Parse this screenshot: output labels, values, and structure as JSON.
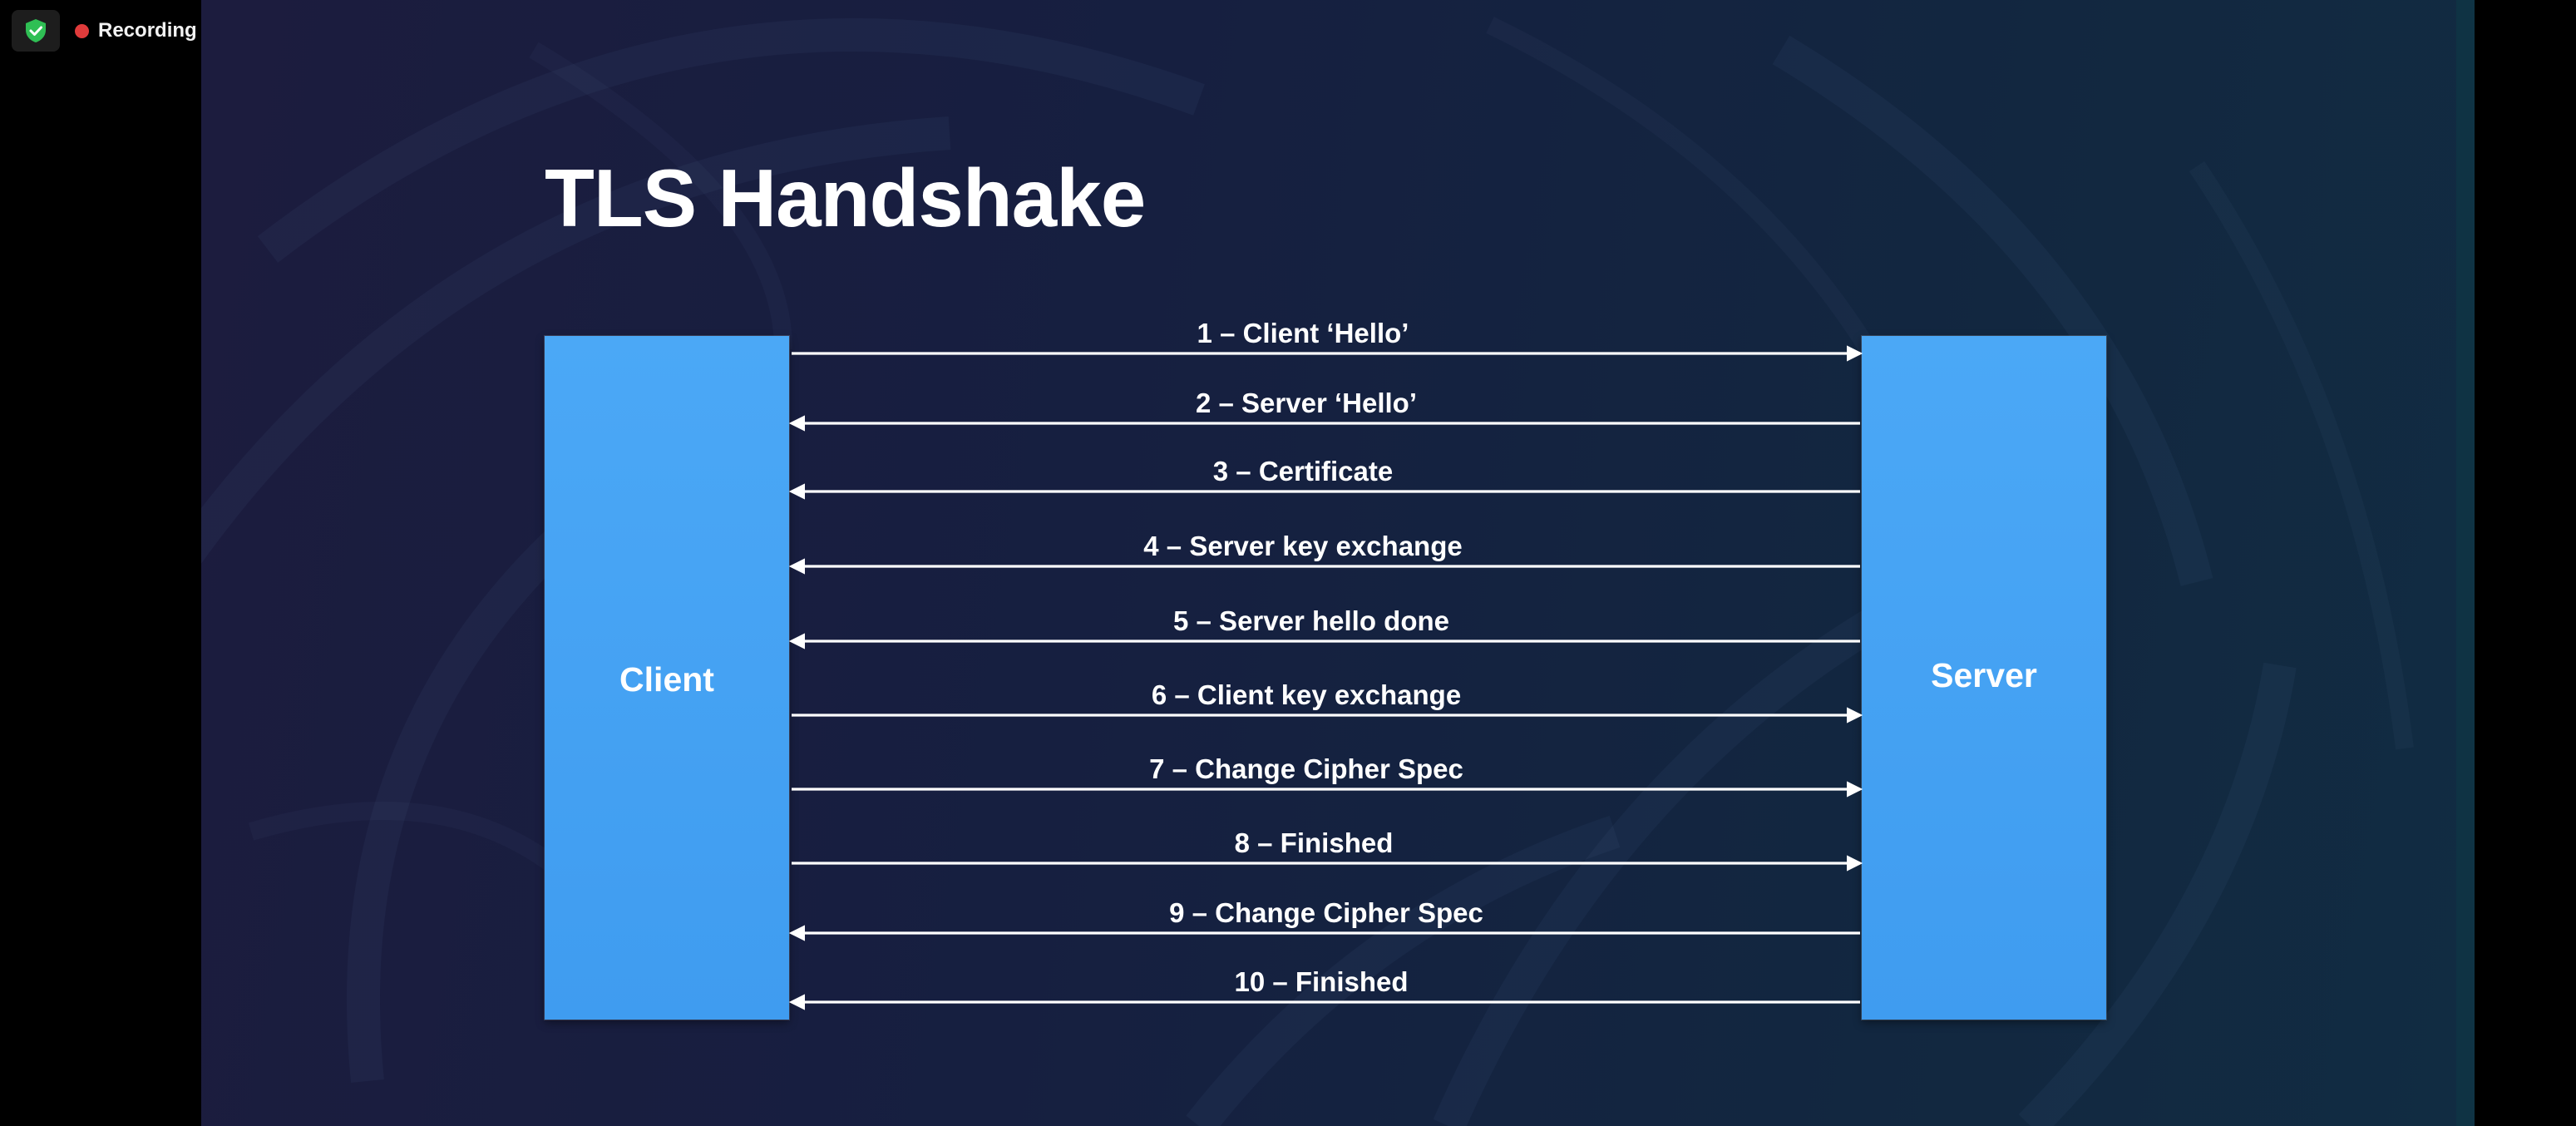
{
  "recording": {
    "label": "Recording",
    "shield_icon": "shield-check-icon",
    "indicator_color": "#e03b3b"
  },
  "slide": {
    "title": "TLS Handshake",
    "client_label": "Client",
    "server_label": "Server",
    "box_color": "#4aa3f4",
    "messages": [
      {
        "label": "1 – Client ‘Hello’",
        "direction": "to-server"
      },
      {
        "label": "2 – Server ‘Hello’",
        "direction": "to-client"
      },
      {
        "label": "3 – Certificate",
        "direction": "to-client"
      },
      {
        "label": "4 – Server key exchange",
        "direction": "to-client"
      },
      {
        "label": "5 – Server hello done",
        "direction": "to-client"
      },
      {
        "label": "6 – Client key exchange",
        "direction": "to-server"
      },
      {
        "label": "7 – Change Cipher Spec",
        "direction": "to-server"
      },
      {
        "label": "8 – Finished",
        "direction": "to-server"
      },
      {
        "label": "9 – Change Cipher Spec",
        "direction": "to-client"
      },
      {
        "label": "10 – Finished",
        "direction": "to-client"
      }
    ]
  }
}
